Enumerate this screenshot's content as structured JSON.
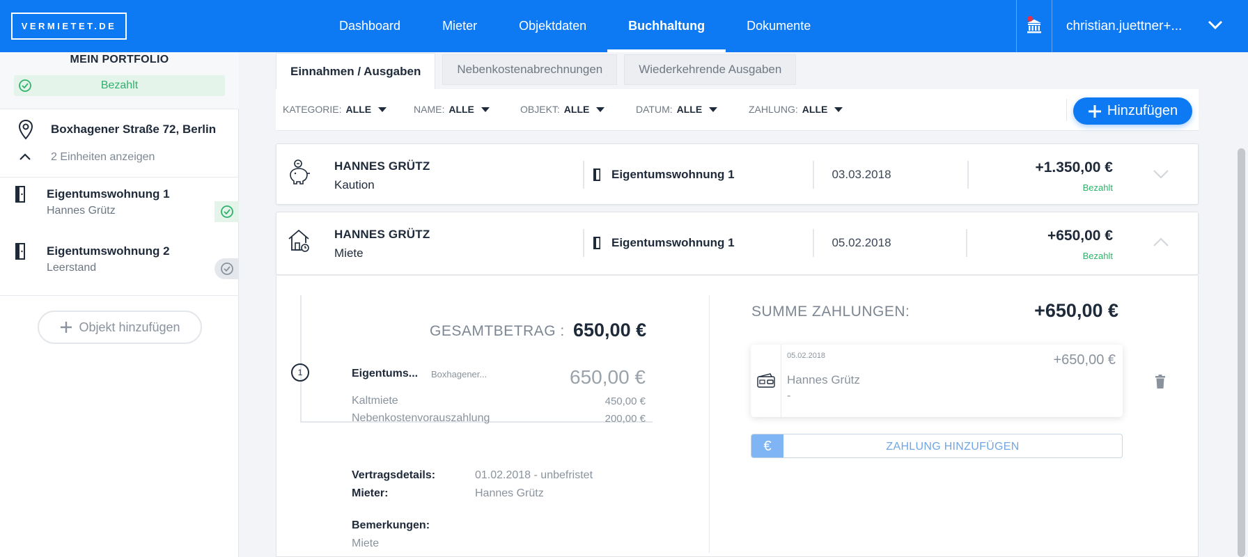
{
  "brand": {
    "logo": "VERMIETET.DE"
  },
  "nav": {
    "items": [
      "Dashboard",
      "Mieter",
      "Objektdaten",
      "Buchhaltung",
      "Dokumente"
    ],
    "active": "Buchhaltung",
    "user": "christian.juettner+..."
  },
  "sidebar": {
    "title": "MEIN PORTFOLIO",
    "status": "Bezahlt",
    "address": "Boxhagener Straße 72, Berlin",
    "units_toggle": "2 Einheiten anzeigen",
    "units": [
      {
        "name": "Eigentumswohnung 1",
        "tenant": "Hannes Grütz",
        "status": "paid"
      },
      {
        "name": "Eigentumswohnung 2",
        "tenant": "Leerstand",
        "status": "empty"
      }
    ],
    "add_object": "Objekt hinzufügen"
  },
  "tabs": [
    "Einnahmen / Ausgaben",
    "Nebenkostenabrechnungen",
    "Wiederkehrende Ausgaben"
  ],
  "filters": [
    {
      "label": "KATEGORIE:",
      "value": "ALLE"
    },
    {
      "label": "NAME:",
      "value": "ALLE"
    },
    {
      "label": "OBJEKT:",
      "value": "ALLE"
    },
    {
      "label": "DATUM:",
      "value": "ALLE"
    },
    {
      "label": "ZAHLUNG:",
      "value": "ALLE"
    }
  ],
  "add_button": "Hinzufügen",
  "transactions": [
    {
      "name": "HANNES GRÜTZ",
      "category": "Kaution",
      "object": "Eigentumswohnung 1",
      "date": "03.03.2018",
      "amount": "+1.350,00 €",
      "status": "Bezahlt",
      "icon": "piggy-bank-icon"
    },
    {
      "name": "HANNES GRÜTZ",
      "category": "Miete",
      "object": "Eigentumswohnung 1",
      "date": "05.02.2018",
      "amount": "+650,00 €",
      "status": "Bezahlt",
      "icon": "house-rent-icon"
    }
  ],
  "detail": {
    "total_label": "GESAMTBETRAG :",
    "total_value": "650,00 €",
    "step": "1",
    "position_title": "Eigentums...",
    "position_sub": "Boxhagener...",
    "position_value": "650,00 €",
    "lines": [
      {
        "label": "Kaltmiete",
        "amount": "450,00 €"
      },
      {
        "label": "Nebenkostenvorauszahlung",
        "amount": "200,00 €"
      }
    ],
    "contract_label": "Vertragsdetails:",
    "contract_value": "01.02.2018 - unbefristet",
    "tenant_label": "Mieter:",
    "tenant_value": "Hannes Grütz",
    "notes_label": "Bemerkungen:",
    "notes_value": "Miete",
    "sum_label": "SUMME ZAHLUNGEN:",
    "sum_value": "+650,00 €",
    "payment": {
      "date": "05.02.2018",
      "amount": "+650,00 €",
      "name": "Hannes Grütz",
      "note": "-"
    },
    "add_payment": "ZAHLUNG HINZUFÜGEN",
    "euro": "€"
  },
  "colors": {
    "primary": "#0d79f2",
    "paid": "#2fb36a"
  }
}
